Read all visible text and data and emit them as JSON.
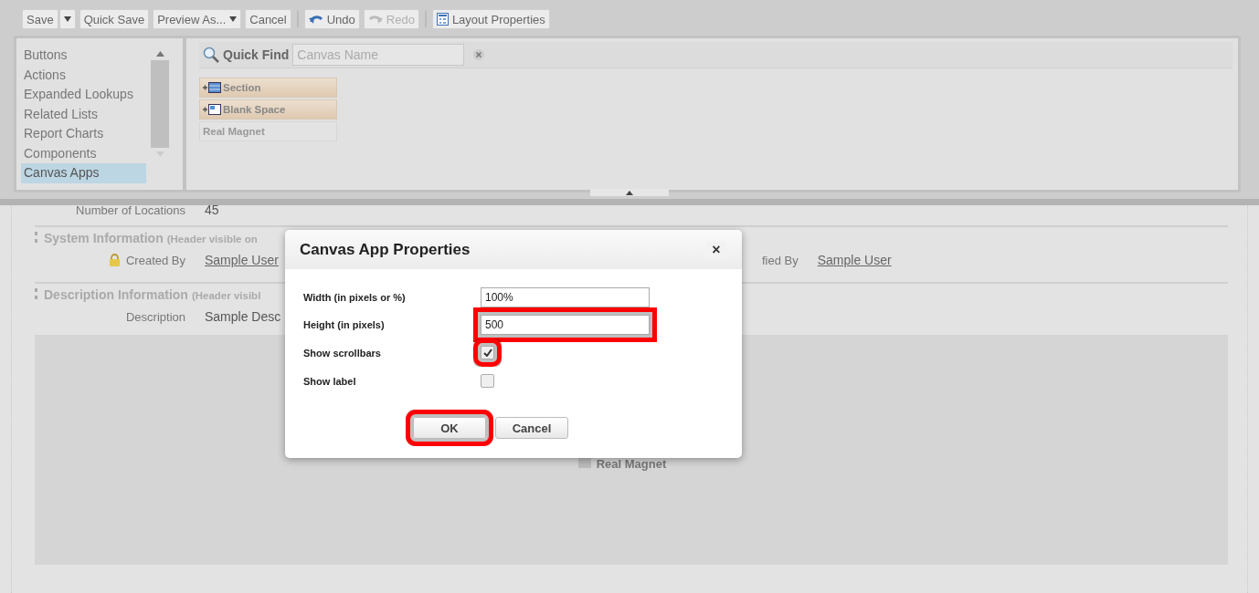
{
  "toolbar": {
    "buttons": [
      {
        "label": "Save",
        "kind": "split",
        "disabled": false
      },
      {
        "label": "Quick Save",
        "kind": "plain",
        "disabled": false
      },
      {
        "label": "Preview As...",
        "kind": "dropdown",
        "disabled": false
      },
      {
        "label": "Cancel",
        "kind": "plain",
        "disabled": false
      },
      {
        "label": "Undo",
        "kind": "undo",
        "disabled": false
      },
      {
        "label": "Redo",
        "kind": "redo",
        "disabled": true
      },
      {
        "label": "Layout Properties",
        "kind": "layout",
        "disabled": false
      }
    ]
  },
  "palette": {
    "categories": [
      {
        "label": "Buttons",
        "selected": false
      },
      {
        "label": "Actions",
        "selected": false
      },
      {
        "label": "Expanded Lookups",
        "selected": false
      },
      {
        "label": "Related Lists",
        "selected": false
      },
      {
        "label": "Report Charts",
        "selected": false
      },
      {
        "label": "Components",
        "selected": false
      },
      {
        "label": "Canvas Apps",
        "selected": true
      }
    ],
    "quick_find": {
      "label": "Quick Find",
      "placeholder": "Canvas Name"
    },
    "items": [
      {
        "label": "Section",
        "kind": "section"
      },
      {
        "label": "Blank Space",
        "kind": "blank"
      },
      {
        "label": "Real Magnet",
        "kind": "canvas"
      }
    ]
  },
  "layout": {
    "top_field": {
      "label": "Number of Locations",
      "value": "45"
    },
    "sections": [
      {
        "title": "System Information",
        "note": "(Header visible on",
        "fields": [
          {
            "label": "Created By",
            "value": "Sample User",
            "locked": true
          }
        ],
        "right_field": {
          "label": "fied By",
          "value": "Sample User"
        }
      },
      {
        "title": "Description Information",
        "note": "(Header visibl",
        "fields": [
          {
            "label": "Description",
            "value": "Sample Desc",
            "locked": false
          }
        ]
      }
    ],
    "canvas_label": "Real Magnet"
  },
  "dialog": {
    "title": "Canvas App Properties",
    "close": "×",
    "fields": [
      {
        "label": "Width (in pixels or %)",
        "kind": "text",
        "value": "100%",
        "highlighted": false
      },
      {
        "label": "Height (in pixels)",
        "kind": "text",
        "value": "500",
        "highlighted": true
      },
      {
        "label": "Show scrollbars",
        "kind": "checkbox",
        "checked": true,
        "highlighted": true
      },
      {
        "label": "Show label",
        "kind": "checkbox",
        "checked": false,
        "highlighted": false
      }
    ],
    "buttons": [
      {
        "label": "OK",
        "highlighted": true
      },
      {
        "label": "Cancel",
        "highlighted": false
      }
    ]
  }
}
